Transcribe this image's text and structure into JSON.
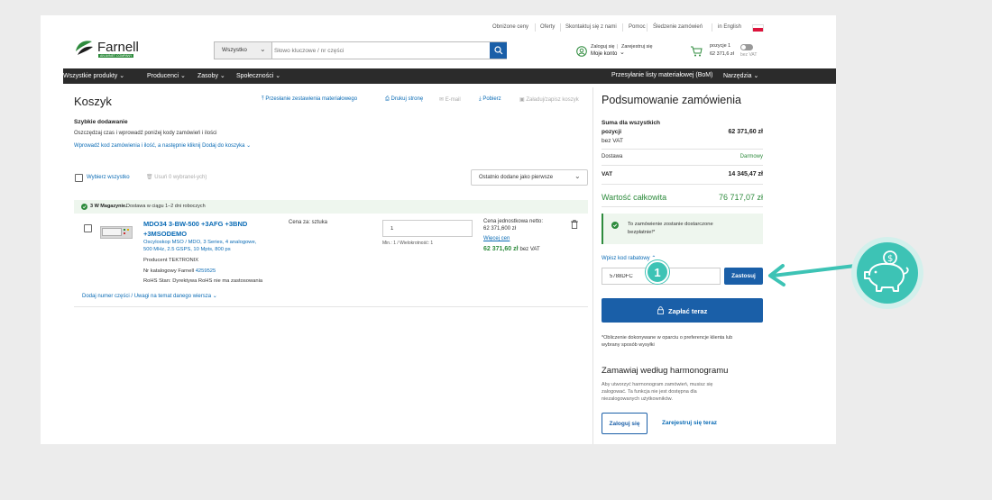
{
  "topbar": {
    "links": [
      "Obniżone ceny",
      "Oferty",
      "Skontaktuj się z nami",
      "Pomoc",
      "Śledzenie zamówień",
      "in English"
    ]
  },
  "header": {
    "logo_text": "Farnell",
    "logo_tagline": "AN AVNET COMPANY",
    "search_category": "Wszystko",
    "search_placeholder": "Słowo kluczowe / nr części",
    "login_line1": "Zaloguj się",
    "login_sep": "|",
    "register": "Zarejestruj się",
    "account": "Moje konto",
    "cart_items": "pozycje 1",
    "cart_total": "62 371,6 zł",
    "vat_toggle_label": "bez VAT"
  },
  "nav": {
    "items": [
      "Wszystkie produkty",
      "Producenci",
      "Zasoby",
      "Społeczności"
    ],
    "right_items": [
      "Przesyłanie listy materiałowej (BoM)",
      "Narzędzia"
    ]
  },
  "cart": {
    "title": "Koszyk",
    "actions": [
      "Przesłanie zestawienia materiałowego",
      "Drukuj stronę",
      "E-mail",
      "Pobierz",
      "Załaduj/zapisz koszyk"
    ],
    "quick_add_title": "Szybkie dodawanie",
    "quick_add_desc": "Oszczędzaj czas i wprowadź poniżej kody zamówień i ilości",
    "quick_add_link": "Wprowadź kod zamówienia i ilość, a następnie kliknij Dodaj do koszyka",
    "select_all": "Wybierz wszystko",
    "remove_selected": "Usuń 0 wybranel-ych)",
    "sort_value": "Ostatnio dodane jako pierwsze",
    "stock_bold": "3 W Magazynie.",
    "stock_rest": "Dostawa w ciągu 1–2 dni roboczych",
    "item": {
      "title_line1": "MDO34 3-BW-500 +3AFG +3BND",
      "title_line2": "+3MSODEMO",
      "desc_line1": "Oscyloskop MSO / MDO, 3 Series, 4 analogowe,",
      "desc_line2": "500 MHz, 2.5 GSPS, 10 Mpts, 800 ps",
      "producer": "Producent",
      "producer_value": "TEKTRONIX",
      "catalog": "Nr katalogowy Farnell",
      "catalog_value": "4259525",
      "rohs": "RoHS Stan:",
      "rohs_value": "Dyrektywa RoHS nie ma zastosowania",
      "price_per": "Cena za: sztuka",
      "qty": "1",
      "min_mult": "Min.: 1 / Wielokrotność: 1",
      "unit_price_label": "Cena jednostkowa netto:",
      "unit_price": "62 371,600 zł",
      "more_prices": "Więcej cen",
      "line_total": "62 371,60 zł",
      "line_total_suffix": "bez VAT"
    },
    "add_part_link": "Dodaj numer części / Uwagi na temat danego wiersza"
  },
  "summary": {
    "title": "Podsumowanie zamówienia",
    "subtotal_label_1": "Suma dla wszystkich",
    "subtotal_label_2": "pozycji",
    "subtotal_label_3": "bez VAT",
    "subtotal_value": "62 371,60 zł",
    "delivery_label": "Dostawa",
    "delivery_value": "Darmowy",
    "vat_label": "VAT",
    "vat_value": "14 345,47 zł",
    "total_label": "Wartość całkowita",
    "total_value": "76 717,07 zł",
    "free_delivery_1": "To zamówienie zostanie dostarczone",
    "free_delivery_2": "bezpłatnie!*",
    "coupon_label": "Wpisz kod rabatowy",
    "coupon_value": "5788DFC",
    "apply_button": "Zastosuj",
    "pay_button": "Zapłać teraz",
    "note_1": "*Obliczenie dokonywane w oparciu o preferencje klienta lub",
    "note_2": "wybrany sposób wysyłki",
    "schedule_title": "Zamawiaj według harmonogramu",
    "schedule_1": "Aby utworzyć harmonogram zamówień, musisz się",
    "schedule_2": "zalogować. Ta funkcja nie jest dostępna dla",
    "schedule_3": "niezalogowanych użytkowników.",
    "login_button": "Zaloguj się",
    "register_link": "Zarejestruj się teraz"
  },
  "callout": {
    "step_number": "1"
  },
  "colors": {
    "brand_blue": "#1a5fa8",
    "link_blue": "#0a6bb5",
    "green": "#2e8b3d",
    "teal": "#3dc3b5"
  }
}
